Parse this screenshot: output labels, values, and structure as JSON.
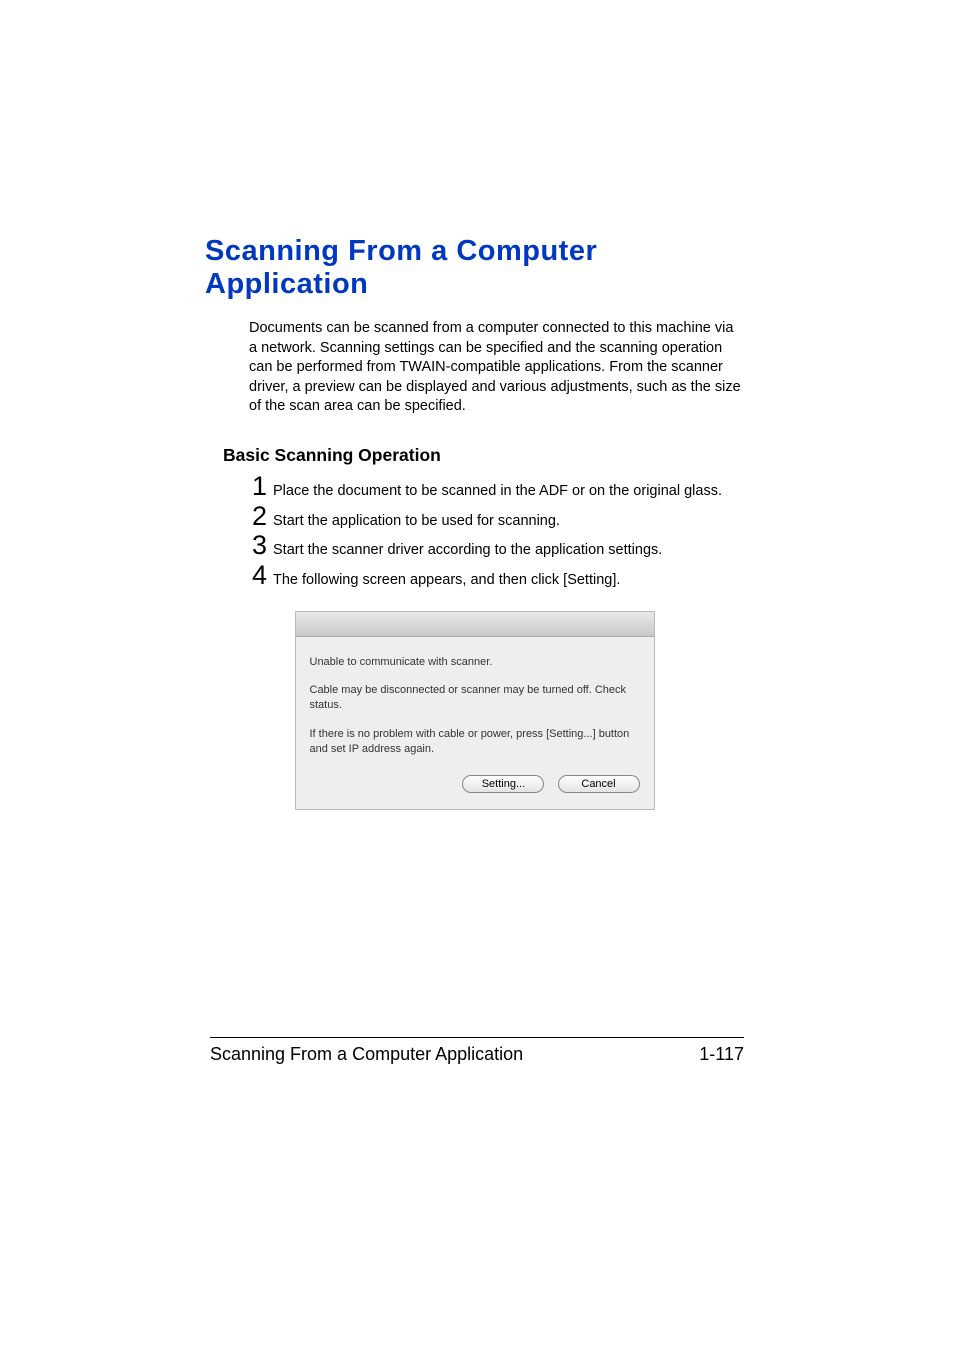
{
  "heading": "Scanning From a Computer Application",
  "intro": "Documents can be scanned from a computer connected to this machine via a network. Scanning settings can be specified and the scanning operation can be performed from TWAIN-compatible applications. From the scanner driver, a preview can be displayed and various adjustments, such as the size of the scan area can be specified.",
  "subheading": "Basic Scanning Operation",
  "steps": {
    "s1": {
      "num": "1",
      "text": "Place the document to be scanned in the ADF or on the original glass."
    },
    "s2": {
      "num": "2",
      "text": "Start the application to be used for scanning."
    },
    "s3": {
      "num": "3",
      "text": "Start the scanner driver according to the application settings."
    },
    "s4": {
      "num": "4",
      "text": "The following screen appears, and then click [Setting]."
    }
  },
  "dialog": {
    "line1": "Unable to communicate with scanner.",
    "line2": "Cable may be disconnected or scanner may be turned off. Check status.",
    "line3": "If there is no problem with cable or power, press [Setting...] button and set IP address again.",
    "setting_label": "Setting...",
    "cancel_label": "Cancel"
  },
  "footer": {
    "title": "Scanning From a Computer Application",
    "pagenum": "1-117"
  }
}
